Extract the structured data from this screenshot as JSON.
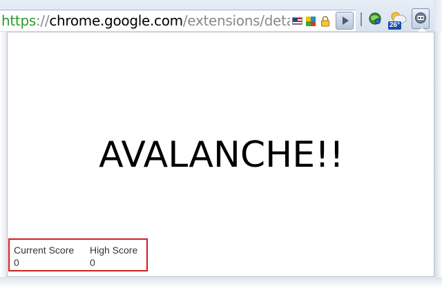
{
  "toolbar": {
    "url": {
      "scheme": "https",
      "separator": "://",
      "host": "chrome.google.com",
      "path": "/extensions/detail/h"
    },
    "icons": [
      "us-flag-icon",
      "color-tiles-icon",
      "lock-icon",
      "play-icon",
      "green-globe-extension-icon",
      "weather-icon",
      "avalanche-extension-icon"
    ],
    "weather_temp": "26°"
  },
  "popup": {
    "title": "AVALANCHE!!",
    "scores": {
      "current_label": "Current Score",
      "current_value": "0",
      "high_label": "High Score",
      "high_value": "0"
    }
  },
  "colors": {
    "score_border": "#cc1d22",
    "url_scheme": "#2a9a2a",
    "url_path": "#888888"
  }
}
